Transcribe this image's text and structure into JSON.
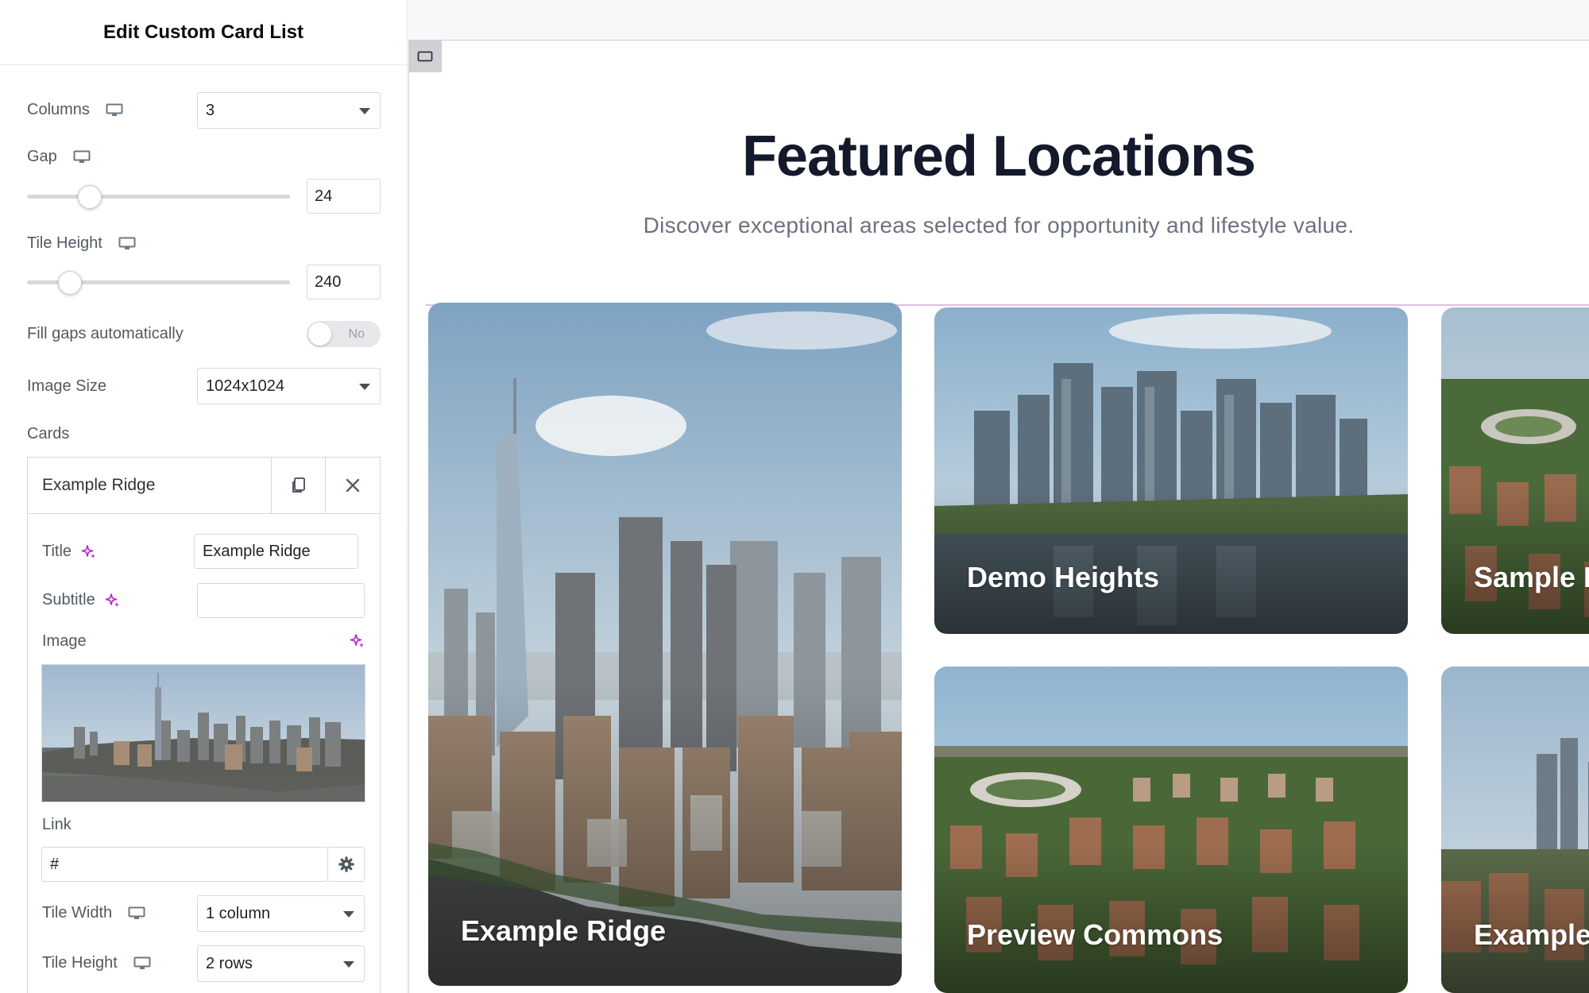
{
  "panel": {
    "title": "Edit Custom Card List",
    "columns": {
      "label": "Columns",
      "value": "3"
    },
    "gap": {
      "label": "Gap",
      "value": "24",
      "fraction": 0.24
    },
    "tile_height": {
      "label": "Tile Height",
      "value": "240",
      "fraction": 0.16
    },
    "fill_gaps": {
      "label": "Fill gaps automatically",
      "state": "No"
    },
    "image_size": {
      "label": "Image Size",
      "value": "1024x1024"
    },
    "cards_label": "Cards",
    "repeater": {
      "item_title": "Example Ridge",
      "title_label": "Title",
      "title_value": "Example Ridge",
      "subtitle_label": "Subtitle",
      "subtitle_value": "",
      "image_label": "Image",
      "link_label": "Link",
      "link_value": "#",
      "tile_width_label": "Tile Width",
      "tile_width_value": "1 column",
      "tile_height_label": "Tile Height",
      "tile_height_value": "2 rows"
    }
  },
  "canvas": {
    "heading": "Featured Locations",
    "subheading": "Discover exceptional areas selected for opportunity and lifestyle value.",
    "cards": [
      {
        "label": "Example Ridge"
      },
      {
        "label": "Demo Heights"
      },
      {
        "label": "Sample E"
      },
      {
        "label": "Preview Commons"
      },
      {
        "label": "Example"
      }
    ]
  },
  "colors": {
    "accent_purple": "#b02ac4",
    "outline_purple": "#e1bfe6",
    "heading": "#141a2b",
    "subheading": "#6b7280"
  },
  "icons": [
    "desktop-icon",
    "sparkle-icon",
    "copy-icon",
    "close-icon",
    "gear-icon",
    "chevron-left-icon",
    "section-icon"
  ]
}
